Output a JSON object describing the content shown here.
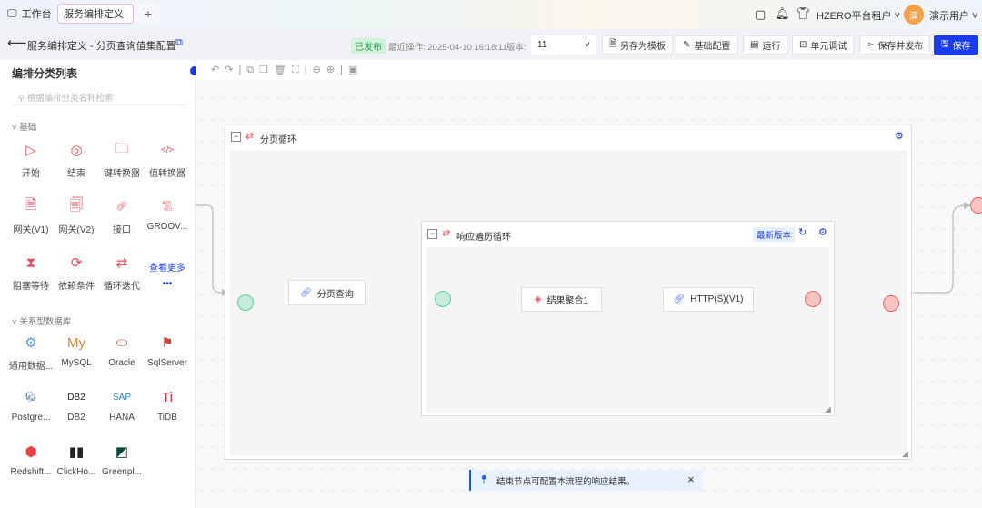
{
  "topbar": {
    "workbench": "工作台",
    "active_tab": "服务编排定义",
    "add_tab": "+",
    "tenant": "HZERO平台租户",
    "user": "演示用户",
    "avatar": "演"
  },
  "header": {
    "title": "服务编排定义 - 分页查询值集配置",
    "status": "已发布",
    "last_op": "最近操作: 2025-04-10 16:18:11",
    "version_label": "版本:",
    "version": "11",
    "buttons": {
      "save_template": "另存为模板",
      "basic_config": "基础配置",
      "run": "运行",
      "unit_debug": "单元调试",
      "save_publish": "保存并发布",
      "save": "保存"
    }
  },
  "sidebar": {
    "title": "编排分类列表",
    "search_placeholder": "根据编排分类名称检索",
    "basic": {
      "label": "基础",
      "items": [
        "开始",
        "结束",
        "键转换器",
        "值转换器",
        "网关(V1)",
        "网关(V2)",
        "接口",
        "GROOV...",
        "阻塞等待",
        "依赖条件",
        "循环迭代"
      ],
      "more": "查看更多",
      "more_dots": "•••"
    },
    "db": {
      "label": "关系型数据库",
      "items": [
        "通用数据...",
        "MySQL",
        "Oracle",
        "SqlServer",
        "Postgre...",
        "DB2",
        "HANA",
        "TiDB",
        "Redshift...",
        "ClickHo...",
        "Greenpl..."
      ]
    }
  },
  "canvas": {
    "outer_loop": "分页循环",
    "page_query": "分页查询",
    "inner_loop": "响应遍历循环",
    "latest_badge": "最新版本",
    "aggregate": "结果聚合1",
    "http": "HTTP(S)(V1)"
  },
  "toast": {
    "text": "结束节点可配置本流程的响应结果。",
    "close": "✕"
  },
  "colors": {
    "primary": "#1a3cf0",
    "node_red": "#e8505b",
    "published": "#d3f2dc"
  }
}
